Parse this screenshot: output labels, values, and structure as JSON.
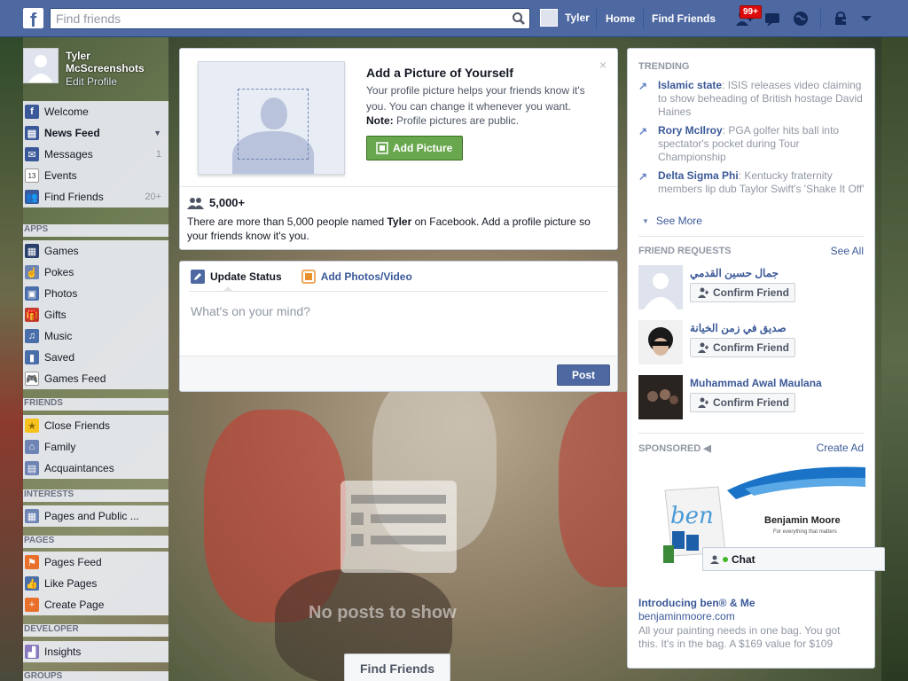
{
  "colors": {
    "topbar": "#4e69a2",
    "link": "#3b5998",
    "green_button": "#69a74e",
    "badge": "#dc0a0a"
  },
  "topbar": {
    "logo": "f",
    "search_placeholder": "Find friends",
    "user_name": "Tyler",
    "home_label": "Home",
    "find_friends_label": "Find Friends",
    "friend_requests_badge": "99+"
  },
  "sidebar": {
    "profile_name": "Tyler McScreenshots",
    "edit_profile": "Edit Profile",
    "main_items": [
      {
        "label": "Welcome",
        "icon": "facebook-icon",
        "count": ""
      },
      {
        "label": "News Feed",
        "icon": "news-feed-icon",
        "count": ""
      },
      {
        "label": "Messages",
        "icon": "messages-icon",
        "count": "1"
      },
      {
        "label": "Events",
        "icon": "calendar-icon",
        "count": ""
      },
      {
        "label": "Find Friends",
        "icon": "find-friends-icon",
        "count": "20+"
      }
    ],
    "apps_header": "APPS",
    "apps_items": [
      {
        "label": "Games",
        "icon": "games-icon"
      },
      {
        "label": "Pokes",
        "icon": "pokes-icon"
      },
      {
        "label": "Photos",
        "icon": "photos-icon"
      },
      {
        "label": "Gifts",
        "icon": "gifts-icon"
      },
      {
        "label": "Music",
        "icon": "music-icon"
      },
      {
        "label": "Saved",
        "icon": "saved-icon"
      },
      {
        "label": "Games Feed",
        "icon": "games-feed-icon"
      }
    ],
    "friends_header": "FRIENDS",
    "friends_items": [
      {
        "label": "Close Friends",
        "icon": "star-icon"
      },
      {
        "label": "Family",
        "icon": "family-icon"
      },
      {
        "label": "Acquaintances",
        "icon": "acquaintances-icon"
      }
    ],
    "interests_header": "INTERESTS",
    "interests_items": [
      {
        "label": "Pages and Public ...",
        "icon": "pages-public-icon"
      }
    ],
    "pages_header": "PAGES",
    "pages_items": [
      {
        "label": "Pages Feed",
        "icon": "pages-feed-icon"
      },
      {
        "label": "Like Pages",
        "icon": "thumbs-up-icon"
      },
      {
        "label": "Create Page",
        "icon": "create-page-icon"
      }
    ],
    "developer_header": "DEVELOPER",
    "developer_items": [
      {
        "label": "Insights",
        "icon": "insights-icon"
      }
    ],
    "groups_header": "GROUPS"
  },
  "profile_picture_card": {
    "title": "Add a Picture of Yourself",
    "description": "Your profile picture helps your friends know it's you. You can change it whenever you want.",
    "note_label": "Note:",
    "note_text": " Profile pictures are public.",
    "button": "Add Picture",
    "close": "×",
    "people_count": "5,000+",
    "people_desc_pre": "There are more than 5,000 people named ",
    "people_desc_name": "Tyler",
    "people_desc_post": " on Facebook. Add a profile picture so your friends know it's you."
  },
  "composer": {
    "tab_status": "Update Status",
    "tab_photos": "Add Photos/Video",
    "placeholder": "What's on your mind?",
    "post_button": "Post"
  },
  "feed": {
    "empty_text": "No posts to show",
    "find_friends_button": "Find Friends"
  },
  "right_column": {
    "trending_header": "TRENDING",
    "trending": [
      {
        "topic": "Islamic state",
        "text": ": ISIS releases video claiming to show beheading of British hostage David Haines"
      },
      {
        "topic": "Rory McIlroy",
        "text": ": PGA golfer hits ball into spectator's pocket during Tour Championship"
      },
      {
        "topic": "Delta Sigma Phi",
        "text": ": Kentucky fraternity members lip dub Taylor Swift's 'Shake It Off'"
      }
    ],
    "see_more": "See More",
    "friend_requests_header": "FRIEND REQUESTS",
    "see_all": "See All",
    "friend_requests": [
      {
        "name": "جمال حسين القدمي",
        "button": "Confirm Friend"
      },
      {
        "name": "صديق في زمن الخيانة",
        "button": "Confirm Friend"
      },
      {
        "name": "Muhammad Awal Maulana",
        "button": "Confirm Friend"
      }
    ],
    "sponsored_header": "SPONSORED",
    "create_ad": "Create Ad",
    "ad": {
      "brand_script": "ben",
      "brand_name": "Benjamin Moore",
      "brand_tagline": "For everything that matters",
      "title": "Introducing ben® & Me",
      "url": "benjaminmoore.com",
      "body": "All your painting needs in one bag. You got this. It's in the bag. A $169 value for $109"
    }
  },
  "chat": {
    "label": "Chat"
  }
}
